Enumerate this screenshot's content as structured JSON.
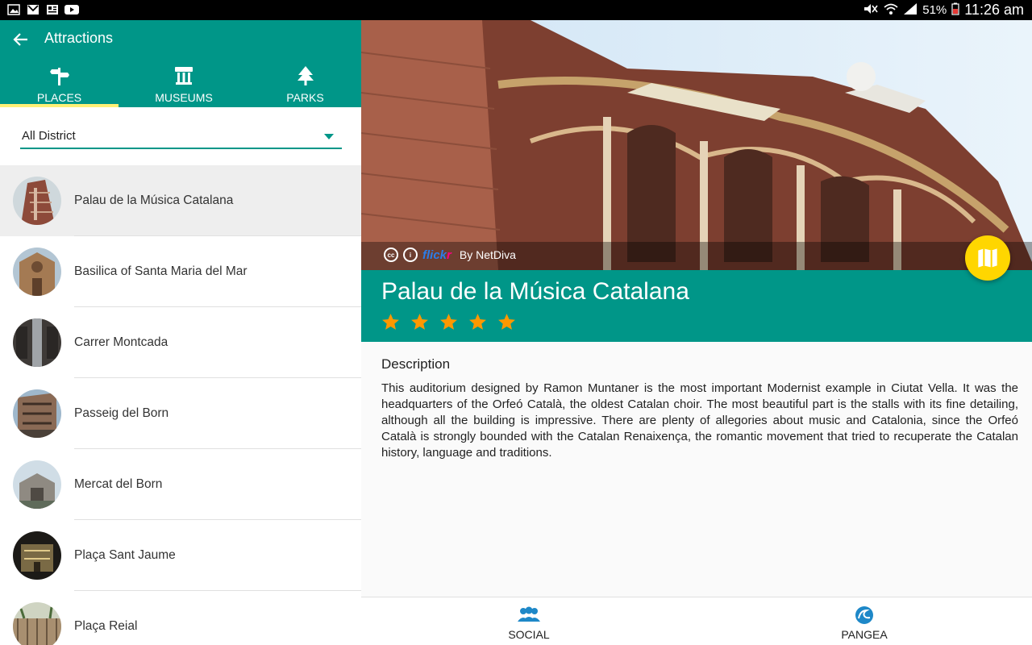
{
  "status": {
    "battery": "51%",
    "time": "11:26 am"
  },
  "appbar": {
    "title": "Attractions"
  },
  "tabs": [
    {
      "label": "PLACES",
      "icon": "signpost-icon",
      "active": true
    },
    {
      "label": "MUSEUMS",
      "icon": "museum-icon",
      "active": false
    },
    {
      "label": "PARKS",
      "icon": "tree-icon",
      "active": false
    }
  ],
  "filter": {
    "selected": "All District"
  },
  "places": [
    {
      "label": "Palau de la Música Catalana",
      "selected": true
    },
    {
      "label": "Basilica of Santa Maria del Mar"
    },
    {
      "label": "Carrer Montcada"
    },
    {
      "label": "Passeig del Born"
    },
    {
      "label": "Mercat del Born"
    },
    {
      "label": "Plaça Sant Jaume"
    },
    {
      "label": "Plaça Reial"
    }
  ],
  "detail": {
    "title": "Palau de la Música Catalana",
    "rating": 5,
    "credit": {
      "flickr_b": "flick",
      "flickr_p": "r",
      "by": "By NetDiva"
    },
    "description_heading": "Description",
    "description": "This auditorium designed by Ramon Muntaner is the most important Modernist example in Ciutat Vella. It was the headquarters of the Orfeó Català, the oldest Catalan choir. The most beautiful part is the stalls with its fine detailing, although all the building is impressive. There are plenty of allegories about music and Catalonia, since the Orfeó Català is strongly bounded with the Catalan Renaixença, the romantic movement that tried to recuperate the Catalan history, language and traditions."
  },
  "bottom_nav": [
    {
      "label": "SOCIAL",
      "icon": "people-icon"
    },
    {
      "label": "PANGEA",
      "icon": "wave-icon"
    }
  ],
  "colors": {
    "teal": "#009688",
    "tab_indicator": "#fff176",
    "fab": "#ffd600",
    "star": "#ff9800"
  }
}
